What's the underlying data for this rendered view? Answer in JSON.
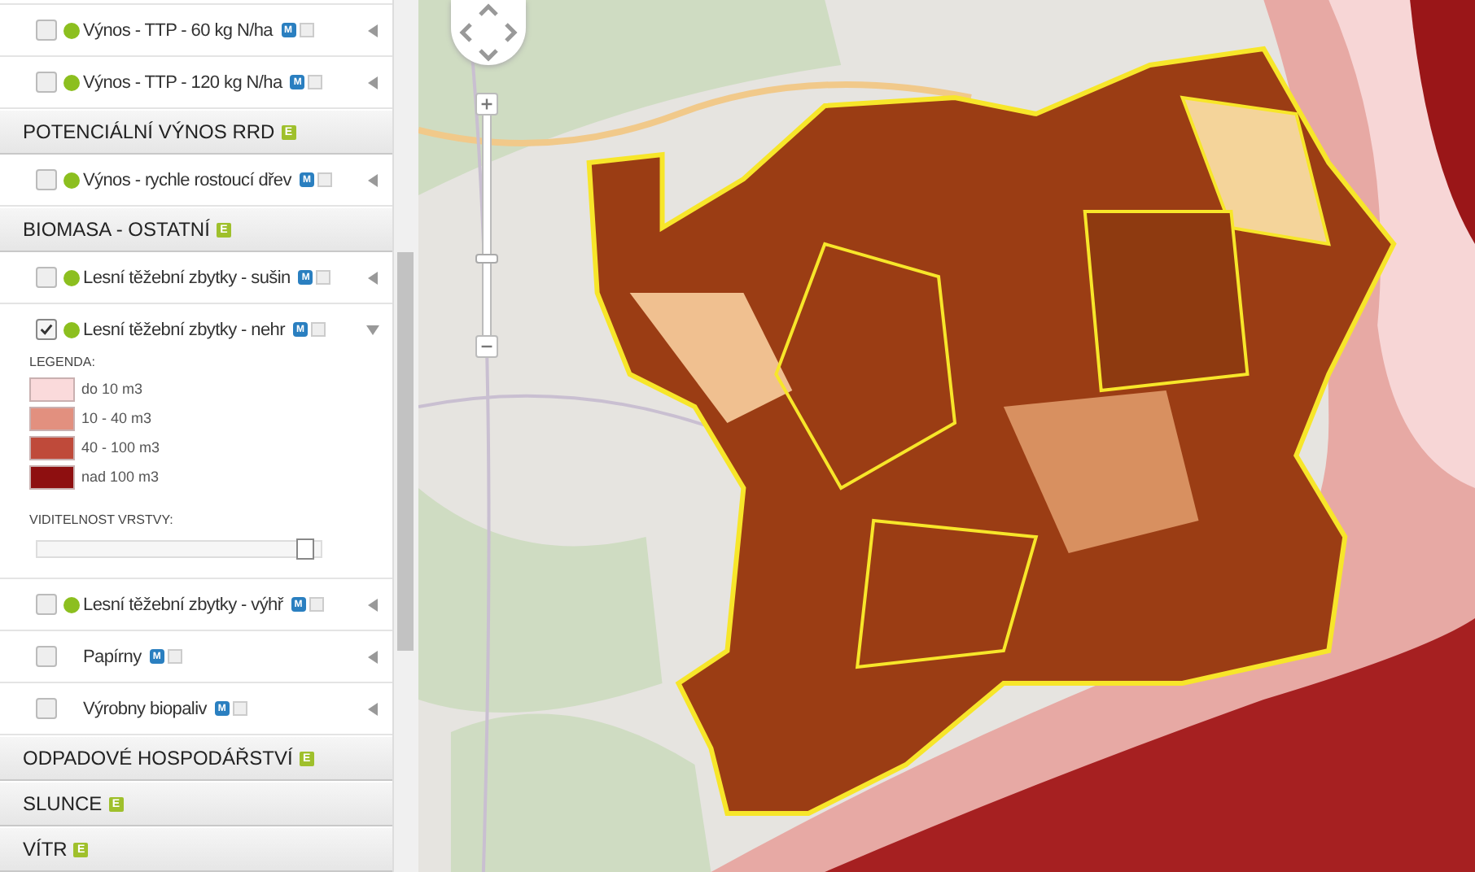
{
  "sidebar": {
    "rows": [
      {
        "kind": "item",
        "label": "Výnos - TTP - 60 kg N/ha",
        "checked": false,
        "dot": true,
        "badge": "M",
        "expanded": false
      },
      {
        "kind": "item",
        "label": "Výnos - TTP - 120 kg N/ha",
        "checked": false,
        "dot": true,
        "badge": "M",
        "expanded": false
      },
      {
        "kind": "header",
        "label": "POTENCIÁLNÍ VÝNOS RRD",
        "badge": "E"
      },
      {
        "kind": "item",
        "label": "Výnos - rychle rostoucí dřev",
        "checked": false,
        "dot": true,
        "badge": "M",
        "expanded": false
      },
      {
        "kind": "header",
        "label": "BIOMASA - OSTATNÍ",
        "badge": "E"
      },
      {
        "kind": "item",
        "label": "Lesní těžební zbytky - sušin",
        "checked": false,
        "dot": true,
        "badge": "M",
        "expanded": false
      },
      {
        "kind": "item",
        "label": "Lesní těžební zbytky - nehr",
        "checked": true,
        "dot": true,
        "badge": "M",
        "expanded": true,
        "legend_title": "LEGENDA:",
        "legend": [
          {
            "label": "do 10 m3",
            "color": "#fadadb"
          },
          {
            "label": "10 - 40 m3",
            "color": "#e2907f"
          },
          {
            "label": "40 - 100 m3",
            "color": "#bf4a3a"
          },
          {
            "label": "nad 100 m3",
            "color": "#8e0f10"
          }
        ],
        "visibility_label": "VIDITELNOST VRSTVY:",
        "visibility": {
          "level": 0.97
        }
      },
      {
        "kind": "item",
        "label": "Lesní těžební zbytky - výhř",
        "checked": false,
        "dot": true,
        "badge": "M",
        "expanded": false
      },
      {
        "kind": "item",
        "label": "Papírny",
        "checked": false,
        "dot": false,
        "badge": "M",
        "expanded": false
      },
      {
        "kind": "item",
        "label": "Výrobny biopaliv",
        "checked": false,
        "dot": false,
        "badge": "M",
        "expanded": false
      },
      {
        "kind": "header",
        "label": "ODPADOVÉ HOSPODÁŘSTVÍ",
        "badge": "E"
      },
      {
        "kind": "header",
        "label": "SLUNCE",
        "badge": "E"
      },
      {
        "kind": "header",
        "label": "VÍTR",
        "badge": "E"
      }
    ]
  },
  "map": {
    "zoom": {
      "level": 0.35
    }
  }
}
